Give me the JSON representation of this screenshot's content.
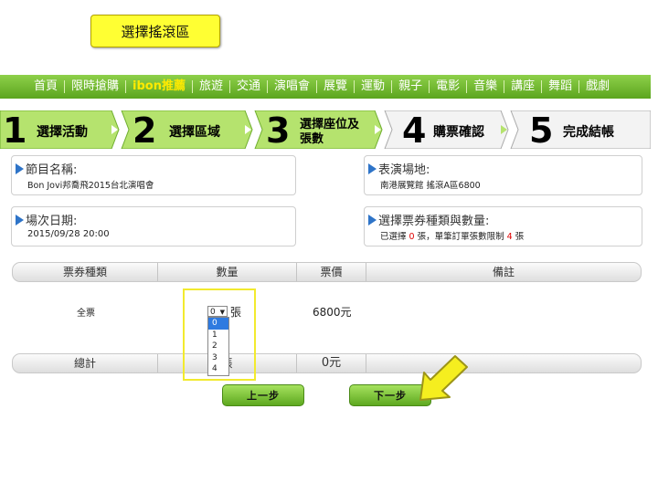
{
  "title": "選擇搖滾區",
  "nav": {
    "items": [
      {
        "label": "首頁",
        "active": false
      },
      {
        "label": "限時搶購",
        "active": false
      },
      {
        "label": "ibon推薦",
        "active": true
      },
      {
        "label": "旅遊",
        "active": false
      },
      {
        "label": "交通",
        "active": false
      },
      {
        "label": "演唱會",
        "active": false
      },
      {
        "label": "展覽",
        "active": false
      },
      {
        "label": "運動",
        "active": false
      },
      {
        "label": "親子",
        "active": false
      },
      {
        "label": "電影",
        "active": false
      },
      {
        "label": "音樂",
        "active": false
      },
      {
        "label": "講座",
        "active": false
      },
      {
        "label": "舞蹈",
        "active": false
      },
      {
        "label": "戲劇",
        "active": false
      }
    ]
  },
  "steps": [
    {
      "num": "1",
      "label": "選擇活動"
    },
    {
      "num": "2",
      "label": "選擇區域"
    },
    {
      "num": "3",
      "label_line1": "選擇座位及",
      "label_line2": "張數"
    },
    {
      "num": "4",
      "label": "購票確認"
    },
    {
      "num": "5",
      "label": "完成結帳"
    }
  ],
  "info": {
    "program_label": "節目名稱:",
    "program_value": "Bon Jovi邦喬飛2015台北演唱會",
    "venue_label": "表演場地:",
    "venue_value": "南港展覽館  搖滾A區6800",
    "date_label": "場次日期:",
    "date_value": "2015/09/28 20:00",
    "ticket_label": "選擇票券種類與數量:",
    "ticket_pre": "已選擇 ",
    "ticket_selected": "0",
    "ticket_mid": " 張，單筆訂單張數限制 ",
    "ticket_limit": "4",
    "ticket_post": " 張"
  },
  "table": {
    "headers": [
      "票券種類",
      "數量",
      "票價",
      "備註"
    ],
    "row": {
      "type": "全票",
      "quantity": "0",
      "unit": "張",
      "price": "6800元"
    },
    "dropdown_options": [
      "0",
      "1",
      "2",
      "3",
      "4"
    ],
    "total_label": "總計",
    "total_qty_unit": "張",
    "total_price": "0元"
  },
  "buttons": {
    "prev": "上一步",
    "next": "下一步"
  },
  "colors": {
    "accent_green": "#5ba51e",
    "highlight_yellow": "#f2ea2e",
    "red": "#e00000",
    "select_blue": "#2e7ae0"
  }
}
